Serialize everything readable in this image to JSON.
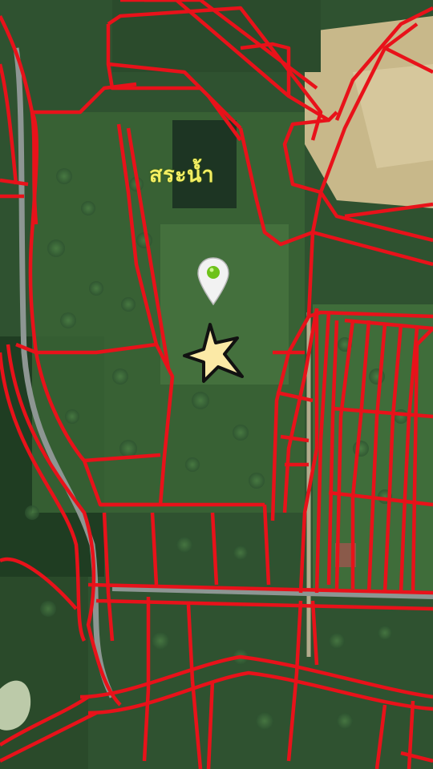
{
  "map": {
    "labels": [
      {
        "id": "pond",
        "text": "สระน้ำ"
      }
    ],
    "markers": [
      {
        "id": "location-pin",
        "icon": "map-pin-icon",
        "color": "#6ec21a"
      },
      {
        "id": "target-star",
        "icon": "star-icon",
        "color": "#fbe9a6"
      }
    ],
    "colors": {
      "parcel_boundary": "#e8121a",
      "label_text": "#f3ee62",
      "forest_dark": "#234323",
      "forest_mid": "#3b6a36",
      "clearing": "#d7c79b",
      "road": "#9aa3a1"
    }
  }
}
